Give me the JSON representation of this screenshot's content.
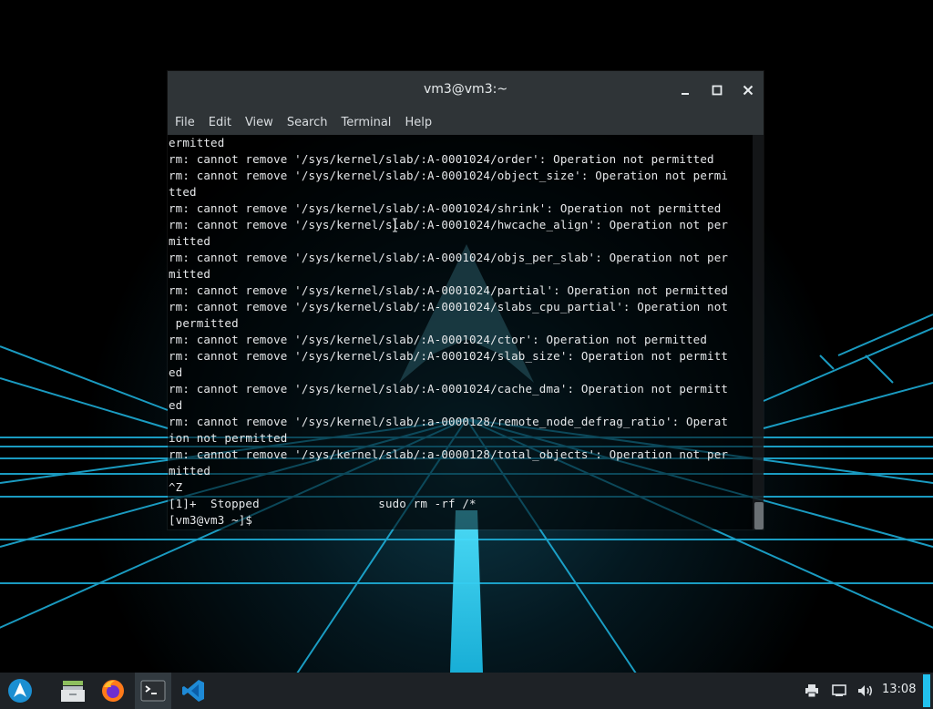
{
  "window": {
    "title": "vm3@vm3:~",
    "controls": [
      "minimize",
      "maximize",
      "close"
    ]
  },
  "menu": [
    "File",
    "Edit",
    "View",
    "Search",
    "Terminal",
    "Help"
  ],
  "terminal": {
    "lines": [
      "ermitted",
      "rm: cannot remove '/sys/kernel/slab/:A-0001024/order': Operation not permitted",
      "rm: cannot remove '/sys/kernel/slab/:A-0001024/object_size': Operation not permi",
      "tted",
      "rm: cannot remove '/sys/kernel/slab/:A-0001024/shrink': Operation not permitted",
      "rm: cannot remove '/sys/kernel/slab/:A-0001024/hwcache_align': Operation not per",
      "mitted",
      "rm: cannot remove '/sys/kernel/slab/:A-0001024/objs_per_slab': Operation not per",
      "mitted",
      "rm: cannot remove '/sys/kernel/slab/:A-0001024/partial': Operation not permitted",
      "rm: cannot remove '/sys/kernel/slab/:A-0001024/slabs_cpu_partial': Operation not",
      " permitted",
      "rm: cannot remove '/sys/kernel/slab/:A-0001024/ctor': Operation not permitted",
      "rm: cannot remove '/sys/kernel/slab/:A-0001024/slab_size': Operation not permitt",
      "ed",
      "rm: cannot remove '/sys/kernel/slab/:A-0001024/cache_dma': Operation not permitt",
      "ed",
      "rm: cannot remove '/sys/kernel/slab/:a-0000128/remote_node_defrag_ratio': Operat",
      "ion not permitted",
      "rm: cannot remove '/sys/kernel/slab/:a-0000128/total_objects': Operation not per",
      "mitted",
      "^Z",
      "[1]+  Stopped                 sudo rm -rf /*",
      "[vm3@vm3 ~]$ "
    ]
  },
  "taskbar": {
    "apps": [
      {
        "name": "arch-menu",
        "label": "Application menu"
      },
      {
        "name": "files",
        "label": "Files"
      },
      {
        "name": "firefox",
        "label": "Firefox"
      },
      {
        "name": "terminal",
        "label": "Terminal"
      },
      {
        "name": "vscode",
        "label": "Visual Studio Code"
      }
    ],
    "tray": [
      "printer-icon",
      "network-icon",
      "volume-icon"
    ],
    "clock": "13:08"
  },
  "colors": {
    "titlebar": "#2f3437",
    "taskbar": "#1e2226",
    "accent": "#22c1ee",
    "terminal_text": "#e6e8ea"
  }
}
